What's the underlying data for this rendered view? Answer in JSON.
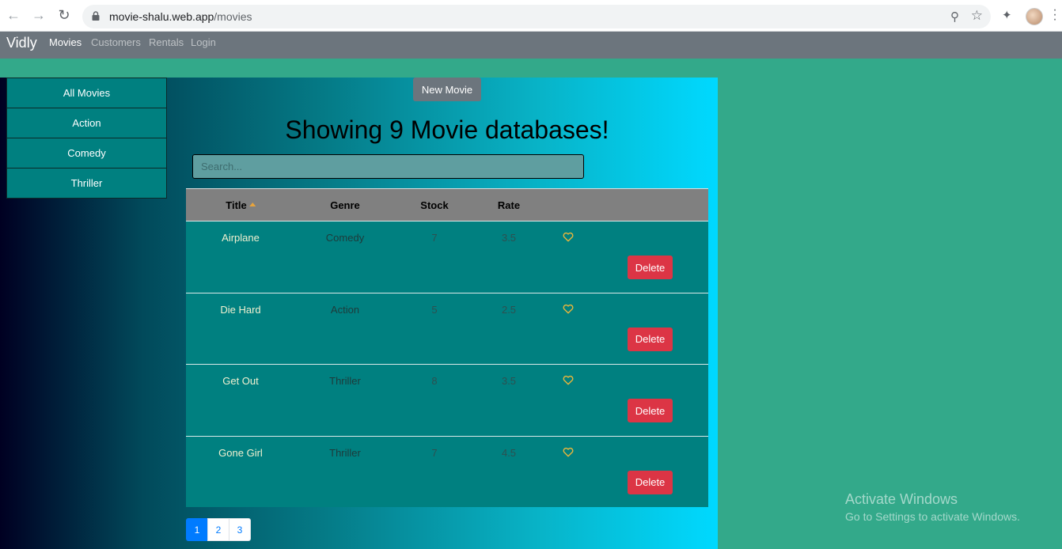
{
  "browser": {
    "url_host": "movie-shalu.web.app",
    "url_path": "/movies"
  },
  "navbar": {
    "brand": "Vidly",
    "links": [
      "Movies",
      "Customers",
      "Rentals",
      "Login"
    ],
    "active": "Movies"
  },
  "genres": [
    "All Movies",
    "Action",
    "Comedy",
    "Thriller"
  ],
  "new_movie_label": "New Movie",
  "heading": "Showing 9 Movie databases!",
  "search": {
    "placeholder": "Search..."
  },
  "table": {
    "columns": [
      "Title",
      "Genre",
      "Stock",
      "Rate"
    ],
    "sort_column": "Title",
    "sort_order": "asc",
    "rows": [
      {
        "title": "Airplane",
        "genre": "Comedy",
        "stock": "7",
        "rate": "3.5"
      },
      {
        "title": "Die Hard",
        "genre": "Action",
        "stock": "5",
        "rate": "2.5"
      },
      {
        "title": "Get Out",
        "genre": "Thriller",
        "stock": "8",
        "rate": "3.5"
      },
      {
        "title": "Gone Girl",
        "genre": "Thriller",
        "stock": "7",
        "rate": "4.5"
      }
    ],
    "delete_label": "Delete"
  },
  "pagination": {
    "pages": [
      "1",
      "2",
      "3"
    ],
    "current": "1"
  },
  "watermark": {
    "line1": "Activate Windows",
    "line2": "Go to Settings to activate Windows."
  },
  "colors": {
    "delete": "#dc3545",
    "table_body": "#008080",
    "table_header": "#808080",
    "navbar": "#6c757d",
    "page_bg": "#33a98a",
    "like_icon": "#e8b63c"
  },
  "icons": [
    "back-icon",
    "forward-icon",
    "reload-icon",
    "lock-icon",
    "zoom-icon",
    "star-icon",
    "extensions-icon",
    "profile-avatar",
    "menu-icon",
    "sort-asc-icon",
    "heart-icon"
  ]
}
